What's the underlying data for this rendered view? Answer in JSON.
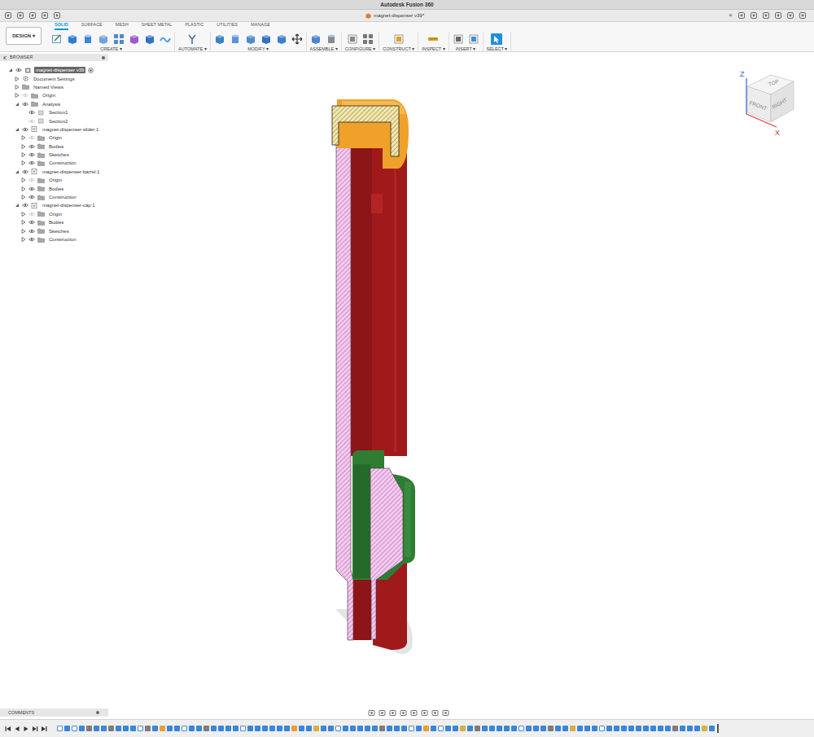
{
  "window": {
    "title": "Autodesk Fusion 360"
  },
  "top_bar": {
    "left_tools": [
      "apps",
      "file",
      "save",
      "undo",
      "redo"
    ],
    "document_tab": {
      "title": "magnet-dispenser v39*",
      "close": "×"
    },
    "right_tools": [
      "new-tab",
      "extensions",
      "jobs",
      "notifications",
      "help",
      "profile"
    ]
  },
  "workspace": {
    "label": "DESIGN ▾"
  },
  "toolbar_tabs": [
    {
      "label": "SOLID",
      "selected": true
    },
    {
      "label": "SURFACE",
      "selected": false
    },
    {
      "label": "MESH",
      "selected": false
    },
    {
      "label": "SHEET METAL",
      "selected": false
    },
    {
      "label": "PLASTIC",
      "selected": false
    },
    {
      "label": "UTILITIES",
      "selected": false
    },
    {
      "label": "MANAGE",
      "selected": false
    }
  ],
  "tool_groups": [
    {
      "label": "CREATE ▾",
      "tools": [
        "sketch",
        "box",
        "cylinder",
        "hole",
        "pattern",
        "component",
        "form",
        "wave"
      ]
    },
    {
      "label": "AUTOMATE ▾",
      "tools": [
        "automate"
      ]
    },
    {
      "label": "MODIFY ▾",
      "tools": [
        "press",
        "fillet",
        "chamfer",
        "shell",
        "combine",
        "move"
      ]
    },
    {
      "label": "ASSEMBLE ▾",
      "tools": [
        "joint",
        "asjoint"
      ]
    },
    {
      "label": "CONFIGURE ▾",
      "tools": [
        "params",
        "table"
      ]
    },
    {
      "label": "CONSTRUCT ▾",
      "tools": [
        "plane"
      ]
    },
    {
      "label": "INSPECT ▾",
      "tools": [
        "measure"
      ]
    },
    {
      "label": "INSERT ▾",
      "tools": [
        "insert",
        "canvas"
      ]
    },
    {
      "label": "SELECT ▾",
      "tools": [
        "select"
      ]
    }
  ],
  "browser": {
    "title": "BROWSER",
    "tree": [
      {
        "label": "magnet-dispenser v39",
        "kind": "document",
        "expanded": true,
        "visible": true,
        "selected": true,
        "children": [
          {
            "label": "Document Settings",
            "kind": "settings",
            "expanded": false,
            "selected": false
          },
          {
            "label": "Named Views",
            "kind": "views",
            "expanded": false,
            "selected": false
          },
          {
            "label": "Origin",
            "kind": "folder",
            "expanded": false,
            "visible": false,
            "selected": false
          },
          {
            "label": "Analysis",
            "kind": "folder",
            "expanded": true,
            "visible": true,
            "selected": false,
            "children": [
              {
                "label": "Section1",
                "kind": "section",
                "visible": true,
                "selected": false
              },
              {
                "label": "Section2",
                "kind": "section",
                "visible": false,
                "selected": false
              }
            ]
          },
          {
            "label": "magnet-dispenser-slider:1",
            "kind": "component",
            "expanded": true,
            "visible": true,
            "selected": false,
            "children": [
              {
                "label": "Origin",
                "kind": "folder",
                "expanded": false,
                "visible": false,
                "selected": false
              },
              {
                "label": "Bodies",
                "kind": "folder",
                "expanded": false,
                "visible": true,
                "selected": false
              },
              {
                "label": "Sketches",
                "kind": "folder",
                "expanded": false,
                "visible": true,
                "selected": false
              },
              {
                "label": "Construction",
                "kind": "folder",
                "expanded": false,
                "visible": true,
                "selected": false
              }
            ]
          },
          {
            "label": "magnet-dispenser-barrel:1",
            "kind": "component",
            "expanded": true,
            "visible": true,
            "selected": false,
            "children": [
              {
                "label": "Origin",
                "kind": "folder",
                "expanded": false,
                "visible": false,
                "selected": false
              },
              {
                "label": "Bodies",
                "kind": "folder",
                "expanded": false,
                "visible": true,
                "selected": false
              },
              {
                "label": "Construction",
                "kind": "folder",
                "expanded": false,
                "visible": true,
                "selected": false
              }
            ]
          },
          {
            "label": "magnet-dispenser-cap:1",
            "kind": "component",
            "expanded": true,
            "visible": true,
            "selected": false,
            "children": [
              {
                "label": "Origin",
                "kind": "folder",
                "expanded": false,
                "visible": false,
                "selected": false
              },
              {
                "label": "Bodies",
                "kind": "folder",
                "expanded": false,
                "visible": true,
                "selected": false
              },
              {
                "label": "Sketches",
                "kind": "folder",
                "expanded": false,
                "visible": true,
                "selected": false
              },
              {
                "label": "Construction",
                "kind": "folder",
                "expanded": false,
                "visible": true,
                "selected": false
              }
            ]
          }
        ]
      }
    ]
  },
  "viewcube": {
    "top": "TOP",
    "front": "FRONT",
    "right": "RIGHT",
    "z_axis": "Z",
    "x_axis": "X"
  },
  "comments": {
    "title": "COMMENTS"
  },
  "navbar": {
    "tools": [
      "orbit",
      "look",
      "pan",
      "zoom",
      "fit",
      "display",
      "grid",
      "viewports"
    ]
  },
  "timeline": {
    "controls": [
      "first",
      "previous",
      "play",
      "next",
      "last"
    ],
    "features": [
      "sketch",
      "extrude",
      "sketch",
      "extrude",
      "joint",
      "extrude",
      "extrude",
      "joint",
      "extrude",
      "extrude",
      "extrude",
      "sketch",
      "joint",
      "extrude",
      "fillet",
      "extrude",
      "extrude",
      "sketch",
      "extrude",
      "extrude",
      "joint",
      "extrude",
      "extrude",
      "extrude",
      "extrude",
      "sketch",
      "extrude",
      "extrude",
      "extrude",
      "extrude",
      "extrude",
      "extrude",
      "fillet",
      "extrude",
      "extrude",
      "plane",
      "extrude",
      "extrude",
      "sketch",
      "extrude",
      "extrude",
      "extrude",
      "extrude",
      "extrude",
      "joint",
      "extrude",
      "extrude",
      "extrude",
      "sketch",
      "extrude",
      "fillet",
      "extrude",
      "sketch",
      "extrude",
      "extrude",
      "plane",
      "extrude",
      "joint",
      "extrude",
      "extrude",
      "extrude",
      "extrude",
      "extrude",
      "sketch",
      "extrude",
      "extrude",
      "extrude",
      "joint",
      "extrude",
      "extrude",
      "plane",
      "extrude",
      "extrude",
      "extrude",
      "sketch",
      "extrude",
      "extrude",
      "extrude",
      "extrude",
      "extrude",
      "extrude",
      "extrude",
      "extrude",
      "extrude",
      "joint",
      "extrude",
      "extrude",
      "extrude",
      "plane",
      "extrude"
    ]
  }
}
